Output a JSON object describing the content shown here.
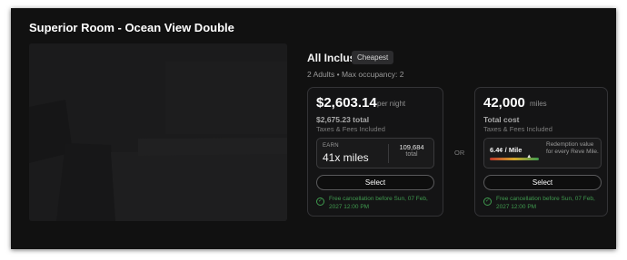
{
  "room": {
    "title": "Superior Room - Ocean View Double"
  },
  "rate": {
    "name": "All Inclusive",
    "badge": "Cheapest",
    "occupancy": "2 Adults  •  Max occupancy: 2"
  },
  "cash_option": {
    "price": "$2,603.14",
    "price_unit": "per night",
    "total": "$2,675.23 total",
    "fees_note": "Taxes & Fees Included",
    "earn": {
      "label": "EARN",
      "value": "41x miles",
      "total_number": "109,684",
      "total_label": "total"
    },
    "select_label": "Select",
    "cancellation": "Free cancellation before Sun, 07 Feb, 2027 12:00 PM"
  },
  "separator": "OR",
  "miles_option": {
    "amount": "42,000",
    "unit": "miles",
    "total_label": "Total cost",
    "fees_note": "Taxes & Fees Included",
    "redemption": {
      "rate": "6.4¢ / Mile",
      "description": "Redemption value for every Reve Mile.",
      "level": 0.8
    },
    "select_label": "Select",
    "cancellation": "Free cancellation before Sun, 07 Feb, 2027 12:00 PM"
  },
  "colors": {
    "background": "#111111",
    "accent_green": "#3f9a4e",
    "redemption_gradient": [
      "#c0392b",
      "#d4a72c",
      "#3f9a4e"
    ]
  }
}
